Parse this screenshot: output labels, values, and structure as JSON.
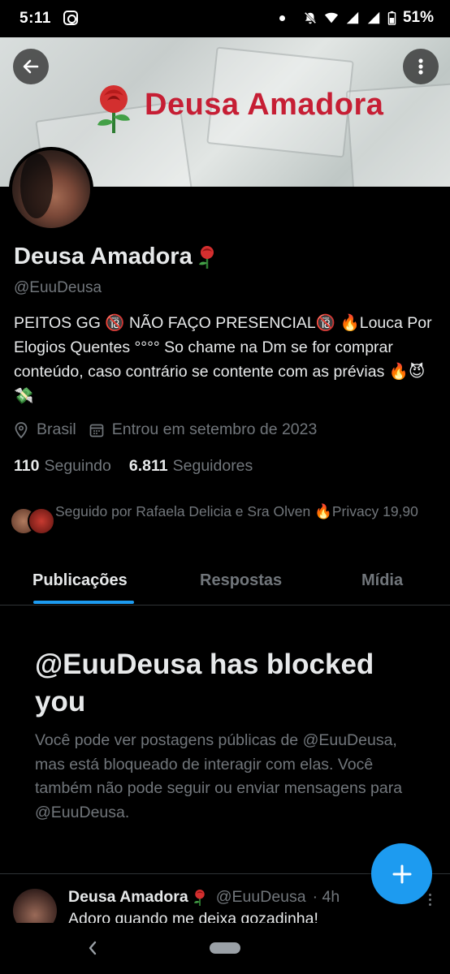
{
  "status_bar": {
    "time": "5:11",
    "battery": "51%"
  },
  "banner": {
    "title": "Deusa Amadora"
  },
  "profile": {
    "name": "Deusa Amadora",
    "handle": "@EuuDeusa",
    "bio": "PEITOS GG 🔞 NÃO FAÇO PRESENCIAL🔞  🔥Louca Por Elogios Quentes °°°° So chame na Dm se for comprar conteúdo, caso contrário se contente com as prévias 🔥😈💸",
    "location": "Brasil",
    "joined": "Entrou em setembro de 2023",
    "following_count": "110",
    "following_label": "Seguindo",
    "followers_count": "6.811",
    "followers_label": "Seguidores",
    "followed_by": "Seguido por Rafaela Delicia e Sra Olven 🔥Privacy 19,90"
  },
  "tabs": [
    {
      "label": "Publicações",
      "active": true
    },
    {
      "label": "Respostas",
      "active": false
    },
    {
      "label": "Mídia",
      "active": false
    }
  ],
  "blocked": {
    "title": "@EuuDeusa has blocked you",
    "message": "Você pode ver postagens públicas de @EuuDeusa, mas está bloqueado de interagir com elas. Você também não pode seguir ou enviar mensagens para @EuuDeusa."
  },
  "tweet": {
    "name": "Deusa Amadora",
    "handle": "@EuuDeusa",
    "time": "· 4h",
    "text": "Adoro quando me deixa gozadinha!"
  },
  "colors": {
    "accent": "#1d9bf0",
    "banner_title": "#c61e34",
    "muted": "#71767b"
  }
}
